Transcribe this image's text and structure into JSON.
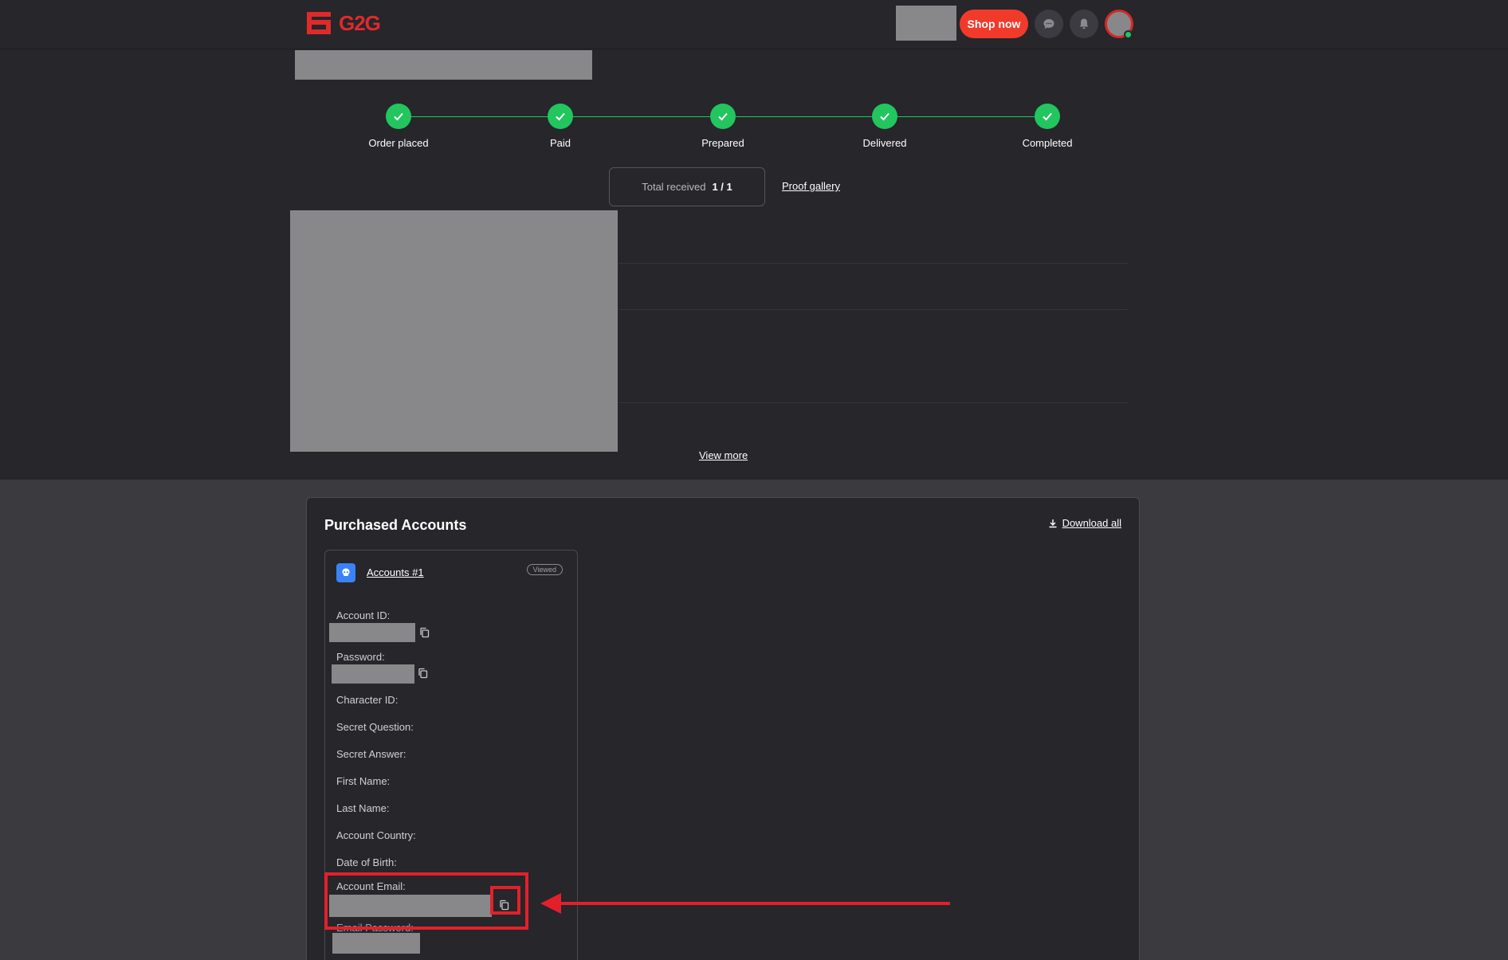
{
  "header": {
    "logo_text": "G2G",
    "shop_label": "Shop now",
    "icons": [
      "chat-icon",
      "bell-icon"
    ]
  },
  "steps": [
    {
      "label": "Order placed"
    },
    {
      "label": "Paid"
    },
    {
      "label": "Prepared"
    },
    {
      "label": "Delivered"
    },
    {
      "label": "Completed"
    }
  ],
  "summary": {
    "total_label": "Total received",
    "total_value": "1 / 1",
    "proof_label": "Proof gallery",
    "view_more": "View more"
  },
  "accounts": {
    "title": "Purchased Accounts",
    "download_all": "Download all",
    "card": {
      "name": "Accounts #1",
      "badge": "Viewed",
      "fields": {
        "account_id": "Account ID:",
        "password": "Password:",
        "character_id": "Character ID:",
        "secret_question": "Secret Question:",
        "secret_answer": "Secret Answer:",
        "first_name": "First Name:",
        "last_name": "Last Name:",
        "account_country": "Account Country:",
        "date_of_birth": "Date of Birth:",
        "account_email": "Account Email:",
        "email_password": "Email Password:"
      }
    }
  },
  "colors": {
    "accent": "#f23a2b",
    "success": "#22c55e",
    "annotation": "#e3202a"
  }
}
